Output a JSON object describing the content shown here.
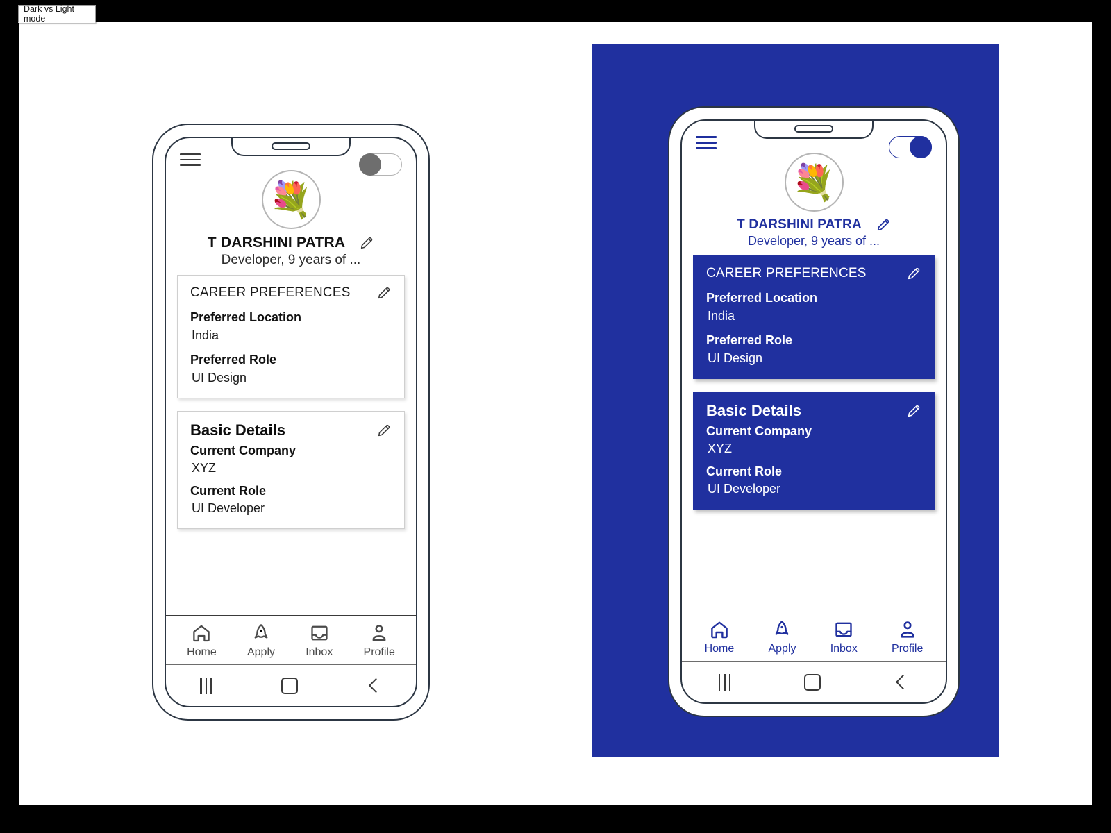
{
  "window": {
    "tab_label": "Dark vs Light mode"
  },
  "colors": {
    "brand_blue": "#20309F",
    "frame_outline": "#2C3643",
    "card_border_light": "#CFCFCF",
    "toggle_off_knob": "#6E6E6E",
    "nav_icon_light": "#4A4A4A"
  },
  "light_mode": {
    "theme": "light",
    "toggle": {
      "state": "off",
      "name": "dark-mode-toggle"
    },
    "menu_icon": "hamburger-icon",
    "avatar": {
      "icon": "bouquet-avatar",
      "glyph": "💐"
    },
    "profile": {
      "name": "T DARSHINI PATRA",
      "subtitle": "Developer, 9 years of ...",
      "edit_icon": "pencil-icon"
    },
    "career_card": {
      "title": "CAREER PREFERENCES",
      "edit_icon": "pencil-icon",
      "fields": [
        {
          "label": "Preferred Location",
          "value": "India"
        },
        {
          "label": "Preferred Role",
          "value": "UI Design"
        }
      ]
    },
    "basic_card": {
      "title": "Basic Details",
      "edit_icon": "pencil-icon",
      "fields": [
        {
          "label": "Current Company",
          "value": "XYZ"
        },
        {
          "label": "Current Role",
          "value": "UI Developer"
        }
      ]
    },
    "bottom_nav": [
      {
        "label": "Home",
        "icon": "home-icon"
      },
      {
        "label": "Apply",
        "icon": "rocket-icon"
      },
      {
        "label": "Inbox",
        "icon": "inbox-icon"
      },
      {
        "label": "Profile",
        "icon": "person-icon"
      }
    ],
    "system_bar": [
      {
        "icon": "recents-icon"
      },
      {
        "icon": "home-square-icon"
      },
      {
        "icon": "back-chevron-icon"
      }
    ]
  },
  "dark_mode": {
    "theme": "dark",
    "toggle": {
      "state": "on",
      "name": "dark-mode-toggle"
    },
    "menu_icon": "hamburger-icon",
    "avatar": {
      "icon": "bouquet-avatar",
      "glyph": "💐"
    },
    "profile": {
      "name": "T DARSHINI PATRA",
      "subtitle": "Developer, 9 years of ...",
      "edit_icon": "pencil-icon"
    },
    "career_card": {
      "title": "CAREER PREFERENCES",
      "edit_icon": "pencil-icon",
      "fields": [
        {
          "label": "Preferred Location",
          "value": "India"
        },
        {
          "label": "Preferred Role",
          "value": "UI Design"
        }
      ]
    },
    "basic_card": {
      "title": "Basic Details",
      "edit_icon": "pencil-icon",
      "fields": [
        {
          "label": "Current Company",
          "value": "XYZ"
        },
        {
          "label": "Current Role",
          "value": "UI Developer"
        }
      ]
    },
    "bottom_nav": [
      {
        "label": "Home",
        "icon": "home-icon"
      },
      {
        "label": "Apply",
        "icon": "rocket-icon"
      },
      {
        "label": "Inbox",
        "icon": "inbox-icon"
      },
      {
        "label": "Profile",
        "icon": "person-icon"
      }
    ],
    "system_bar": [
      {
        "icon": "recents-icon"
      },
      {
        "icon": "home-square-icon"
      },
      {
        "icon": "back-chevron-icon"
      }
    ]
  }
}
